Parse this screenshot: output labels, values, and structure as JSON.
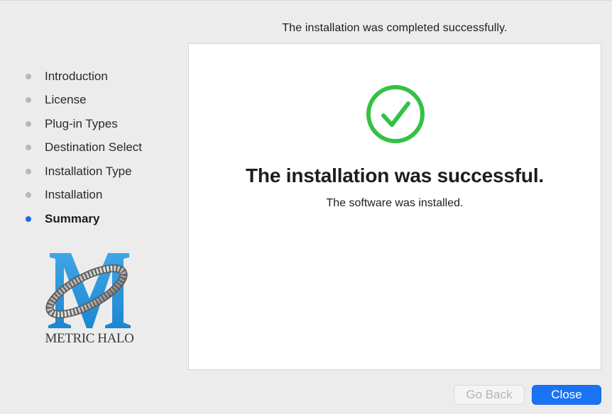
{
  "header": {
    "status_text": "The installation was completed successfully."
  },
  "sidebar": {
    "steps": [
      {
        "label": "Introduction",
        "state": "done"
      },
      {
        "label": "License",
        "state": "done"
      },
      {
        "label": "Plug-in Types",
        "state": "done"
      },
      {
        "label": "Destination Select",
        "state": "done"
      },
      {
        "label": "Installation Type",
        "state": "done"
      },
      {
        "label": "Installation",
        "state": "done"
      },
      {
        "label": "Summary",
        "state": "current"
      }
    ],
    "logo": {
      "icon": "metric-halo-logo",
      "caption": "METRIC HALO"
    }
  },
  "main": {
    "icon": "checkmark-circle-icon",
    "title": "The installation was successful.",
    "subtitle": "The software was installed."
  },
  "buttons": {
    "back_label": "Go Back",
    "back_enabled": false,
    "close_label": "Close"
  },
  "colors": {
    "accent": "#1a73f2",
    "success": "#33c244",
    "inactive_dot": "#b8b8b8"
  }
}
